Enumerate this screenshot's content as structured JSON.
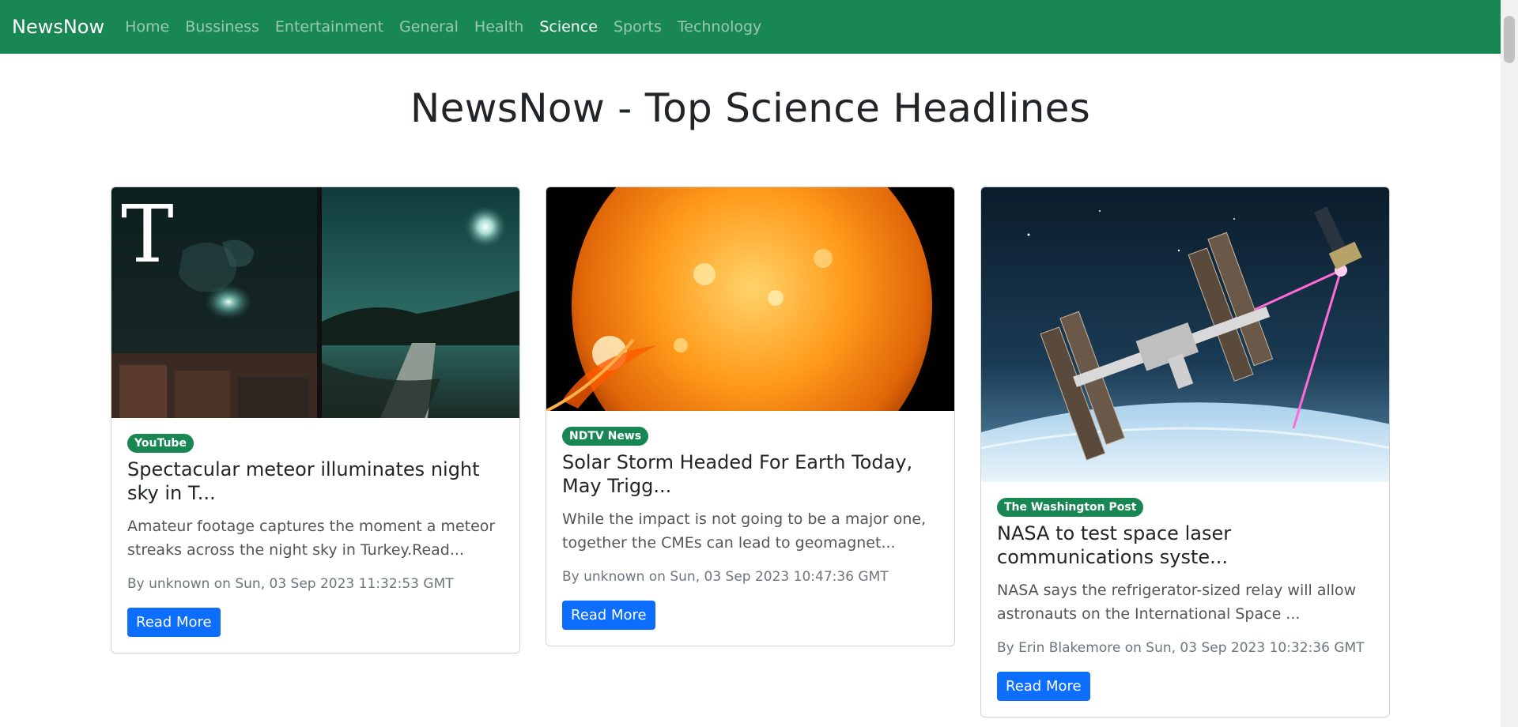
{
  "nav": {
    "brand": "NewsNow",
    "links": [
      "Home",
      "Bussiness",
      "Entertainment",
      "General",
      "Health",
      "Science",
      "Sports",
      "Technology"
    ],
    "active": "Science",
    "color": "#198754"
  },
  "page": {
    "title": "NewsNow - Top Science Headlines"
  },
  "articles": [
    {
      "source": "YouTube",
      "title": "Spectacular meteor illuminates night sky in T...",
      "description": "Amateur footage captures the moment a meteor streaks across the night sky in Turkey.Read...",
      "meta": "By unknown on Sun, 03 Sep 2023 11:32:53 GMT",
      "button": "Read More",
      "image_logo": "T"
    },
    {
      "source": "NDTV News",
      "title": "Solar Storm Headed For Earth Today, May Trigg...",
      "description": "While the impact is not going to be a major one, together the CMEs can lead to geomagnet...",
      "meta": "By unknown on Sun, 03 Sep 2023 10:47:36 GMT",
      "button": "Read More"
    },
    {
      "source": "The Washington Post",
      "title": "NASA to test space laser communications syste...",
      "description": "NASA says the refrigerator-sized relay will allow astronauts on the International Space ...",
      "meta": "By Erin Blakemore on Sun, 03 Sep 2023 10:32:36 GMT",
      "button": "Read More"
    }
  ]
}
